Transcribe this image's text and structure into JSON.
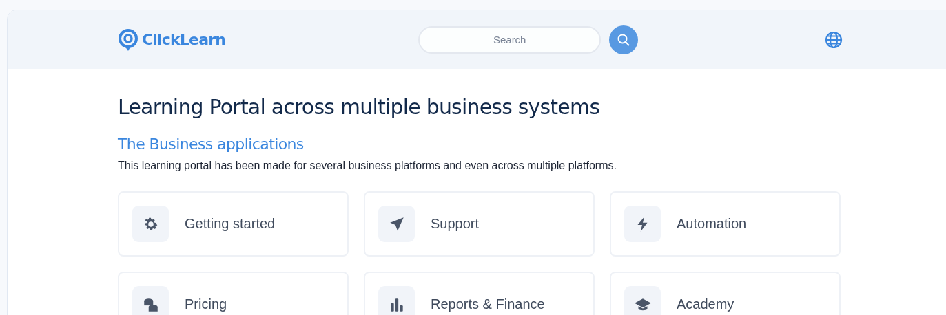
{
  "header": {
    "logo": "ClickLearn",
    "search": {
      "placeholder": "Search"
    }
  },
  "title": "Learning Portal across multiple business systems",
  "section": {
    "heading": "The Business applications",
    "description": "This learning portal has been made for several business platforms and even across multiple platforms."
  },
  "cards": [
    {
      "label": "Getting started"
    },
    {
      "label": "Support"
    },
    {
      "label": "Automation"
    },
    {
      "label": "Pricing"
    },
    {
      "label": "Reports & Finance"
    },
    {
      "label": "Academy"
    }
  ]
}
